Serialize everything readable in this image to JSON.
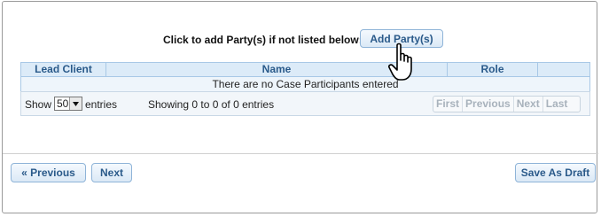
{
  "add_party": {
    "prompt": "Click to add Party(s) if not listed below:",
    "button_label": "Add Party(s)"
  },
  "table": {
    "columns": [
      "Lead Client",
      "Name",
      "Role",
      ""
    ],
    "empty_message": "There are no Case Participants entered"
  },
  "length_control": {
    "show_label": "Show",
    "selected_value": "50",
    "entries_label": "entries"
  },
  "info": "Showing 0 to 0 of 0 entries",
  "pagination": [
    "First",
    "Previous",
    "Next",
    "Last"
  ],
  "nav": {
    "previous_label": "« Previous",
    "next_label": "Next",
    "save_draft_label": "Save As Draft"
  },
  "icons": {
    "cursor": "hand-pointer-icon",
    "dropdown": "chevron-down-icon"
  }
}
